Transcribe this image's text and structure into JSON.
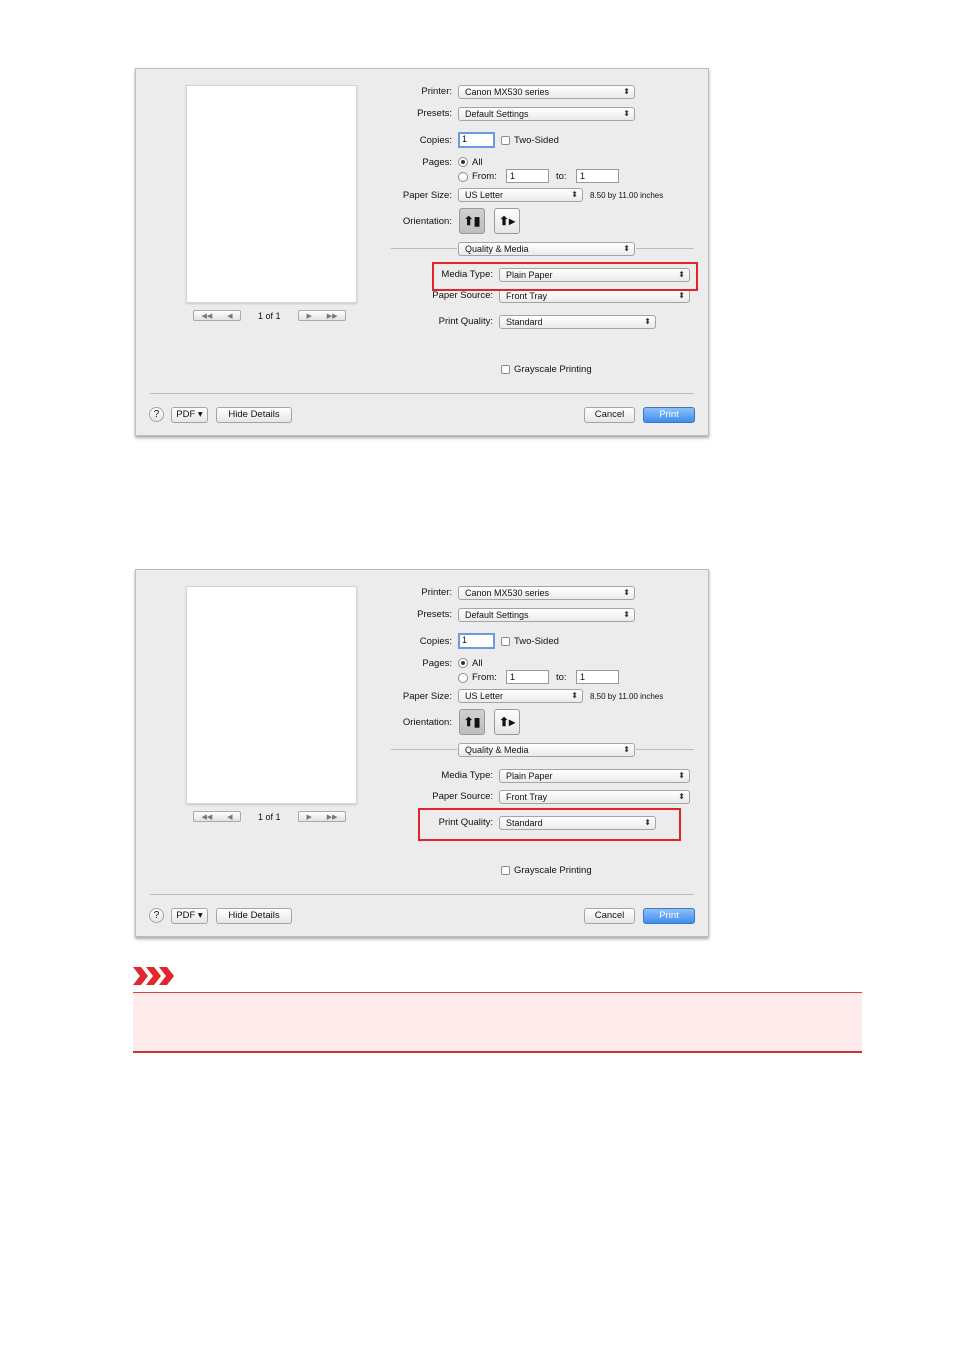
{
  "dialogs": [
    {
      "printer": {
        "label": "Printer:",
        "value": "Canon MX530 series"
      },
      "presets": {
        "label": "Presets:",
        "value": "Default Settings"
      },
      "copies": {
        "label": "Copies:",
        "value": "1",
        "two_sided": "Two-Sided"
      },
      "pages": {
        "label": "Pages:",
        "all": "All",
        "from": "From:",
        "from_value": "1",
        "to": "to:",
        "to_value": "1"
      },
      "paper_size": {
        "label": "Paper Size:",
        "value": "US Letter",
        "dimensions": "8.50 by 11.00 inches"
      },
      "orientation": {
        "label": "Orientation:"
      },
      "section": "Quality & Media",
      "media_type": {
        "label": "Media Type:",
        "value": "Plain Paper"
      },
      "paper_source": {
        "label": "Paper Source:",
        "value": "Front Tray"
      },
      "print_quality": {
        "label": "Print Quality:",
        "value": "Standard"
      },
      "grayscale": "Grayscale Printing",
      "page_count": "1 of 1",
      "buttons": {
        "help": "?",
        "pdf": "PDF ▾",
        "hide_details": "Hide Details",
        "cancel": "Cancel",
        "print": "Print"
      },
      "highlighted": "media_type"
    },
    {
      "printer": {
        "label": "Printer:",
        "value": "Canon MX530 series"
      },
      "presets": {
        "label": "Presets:",
        "value": "Default Settings"
      },
      "copies": {
        "label": "Copies:",
        "value": "1",
        "two_sided": "Two-Sided"
      },
      "pages": {
        "label": "Pages:",
        "all": "All",
        "from": "From:",
        "from_value": "1",
        "to": "to:",
        "to_value": "1"
      },
      "paper_size": {
        "label": "Paper Size:",
        "value": "US Letter",
        "dimensions": "8.50 by 11.00 inches"
      },
      "orientation": {
        "label": "Orientation:"
      },
      "section": "Quality & Media",
      "media_type": {
        "label": "Media Type:",
        "value": "Plain Paper"
      },
      "paper_source": {
        "label": "Paper Source:",
        "value": "Front Tray"
      },
      "print_quality": {
        "label": "Print Quality:",
        "value": "Standard"
      },
      "grayscale": "Grayscale Printing",
      "page_count": "1 of 1",
      "buttons": {
        "help": "?",
        "pdf": "PDF ▾",
        "hide_details": "Hide Details",
        "cancel": "Cancel",
        "print": "Print"
      },
      "highlighted": "print_quality"
    }
  ],
  "colors": {
    "highlight": "#e0242b",
    "important_bg": "#fdeceb",
    "default_button": "#3d8ef0"
  }
}
